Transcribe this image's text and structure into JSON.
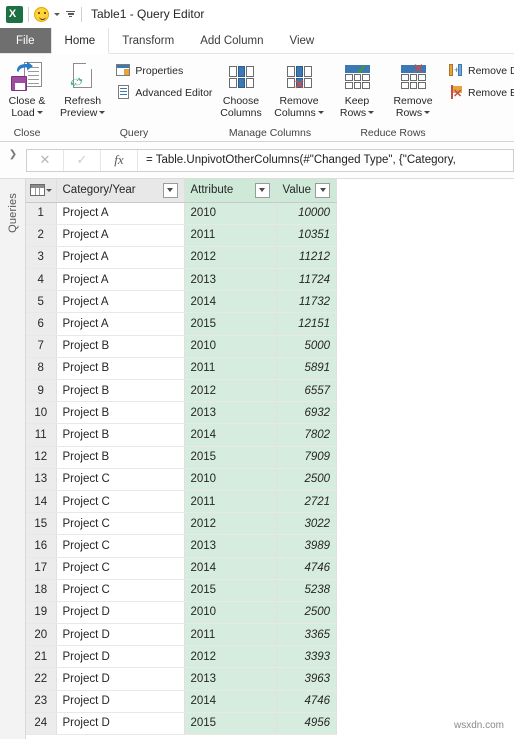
{
  "titlebar": {
    "app_icon": "excel-icon",
    "smiley_icon": "smiley-icon",
    "qat_overflow_icon": "qat-overflow-icon",
    "title": "Table1 - Query Editor"
  },
  "tabs": [
    {
      "label": "File",
      "state": "file"
    },
    {
      "label": "Home",
      "state": "active"
    },
    {
      "label": "Transform",
      "state": "normal"
    },
    {
      "label": "Add Column",
      "state": "normal"
    },
    {
      "label": "View",
      "state": "normal"
    }
  ],
  "ribbon": {
    "groups": [
      {
        "label": "Close",
        "big_buttons": [
          {
            "label_line1": "Close &",
            "label_line2": "Load",
            "icon": "close-and-load-icon",
            "has_dropdown": true
          }
        ],
        "small_buttons": []
      },
      {
        "label": "Query",
        "big_buttons": [
          {
            "label_line1": "Refresh",
            "label_line2": "Preview",
            "icon": "refresh-preview-icon",
            "has_dropdown": true
          }
        ],
        "small_buttons": [
          {
            "label": "Properties",
            "icon": "properties-icon"
          },
          {
            "label": "Advanced Editor",
            "icon": "advanced-editor-icon"
          }
        ]
      },
      {
        "label": "Manage Columns",
        "big_buttons": [
          {
            "label_line1": "Choose",
            "label_line2": "Columns",
            "icon": "choose-columns-icon",
            "has_dropdown": false
          },
          {
            "label_line1": "Remove",
            "label_line2": "Columns",
            "icon": "remove-columns-icon",
            "has_dropdown": true
          }
        ],
        "small_buttons": []
      },
      {
        "label": "Reduce Rows",
        "big_buttons": [
          {
            "label_line1": "Keep",
            "label_line2": "Rows",
            "icon": "keep-rows-icon",
            "has_dropdown": true
          },
          {
            "label_line1": "Remove",
            "label_line2": "Rows",
            "icon": "remove-rows-icon",
            "has_dropdown": true
          }
        ],
        "small_buttons": [
          {
            "label": "Remove D",
            "icon": "remove-duplicates-icon"
          },
          {
            "label": "Remove Er",
            "icon": "remove-errors-icon"
          }
        ]
      }
    ]
  },
  "formula_bar": {
    "cancel_icon": "cancel-icon",
    "confirm_icon": "confirm-icon",
    "fx_icon": "fx-icon",
    "formula": "= Table.UnpivotOtherColumns(#\"Changed Type\", {\"Category,"
  },
  "sidebar": {
    "expand_icon": "chevron-right-icon",
    "label": "Queries"
  },
  "grid": {
    "corner_icon": "table-options-icon",
    "filter_icon": "filter-dropdown-icon",
    "columns": [
      {
        "name": "Category/Year",
        "highlight": false
      },
      {
        "name": "Attribute",
        "highlight": true
      },
      {
        "name": "Value",
        "highlight": true
      }
    ],
    "rows": [
      {
        "n": "1",
        "category": "Project A",
        "attribute": "2010",
        "value": "10000"
      },
      {
        "n": "2",
        "category": "Project A",
        "attribute": "2011",
        "value": "10351"
      },
      {
        "n": "3",
        "category": "Project A",
        "attribute": "2012",
        "value": "11212"
      },
      {
        "n": "4",
        "category": "Project A",
        "attribute": "2013",
        "value": "11724"
      },
      {
        "n": "5",
        "category": "Project A",
        "attribute": "2014",
        "value": "11732"
      },
      {
        "n": "6",
        "category": "Project A",
        "attribute": "2015",
        "value": "12151"
      },
      {
        "n": "7",
        "category": "Project B",
        "attribute": "2010",
        "value": "5000"
      },
      {
        "n": "8",
        "category": "Project B",
        "attribute": "2011",
        "value": "5891"
      },
      {
        "n": "9",
        "category": "Project B",
        "attribute": "2012",
        "value": "6557"
      },
      {
        "n": "10",
        "category": "Project B",
        "attribute": "2013",
        "value": "6932"
      },
      {
        "n": "11",
        "category": "Project B",
        "attribute": "2014",
        "value": "7802"
      },
      {
        "n": "12",
        "category": "Project B",
        "attribute": "2015",
        "value": "7909"
      },
      {
        "n": "13",
        "category": "Project C",
        "attribute": "2010",
        "value": "2500"
      },
      {
        "n": "14",
        "category": "Project C",
        "attribute": "2011",
        "value": "2721"
      },
      {
        "n": "15",
        "category": "Project C",
        "attribute": "2012",
        "value": "3022"
      },
      {
        "n": "16",
        "category": "Project C",
        "attribute": "2013",
        "value": "3989"
      },
      {
        "n": "17",
        "category": "Project C",
        "attribute": "2014",
        "value": "4746"
      },
      {
        "n": "18",
        "category": "Project C",
        "attribute": "2015",
        "value": "5238"
      },
      {
        "n": "19",
        "category": "Project D",
        "attribute": "2010",
        "value": "2500"
      },
      {
        "n": "20",
        "category": "Project D",
        "attribute": "2011",
        "value": "3365"
      },
      {
        "n": "21",
        "category": "Project D",
        "attribute": "2012",
        "value": "3393"
      },
      {
        "n": "22",
        "category": "Project D",
        "attribute": "2013",
        "value": "3963"
      },
      {
        "n": "23",
        "category": "Project D",
        "attribute": "2014",
        "value": "4746"
      },
      {
        "n": "24",
        "category": "Project D",
        "attribute": "2015",
        "value": "4956"
      }
    ]
  },
  "watermark": {
    "text": "wsxdn.com"
  },
  "colors": {
    "accent_green": "#1d7044",
    "new_column_header": "#cfe9d8",
    "new_column_cell": "#d6ecde",
    "file_tab": "#6f6f6f",
    "ribbon_bg": "#fdfdfd"
  }
}
